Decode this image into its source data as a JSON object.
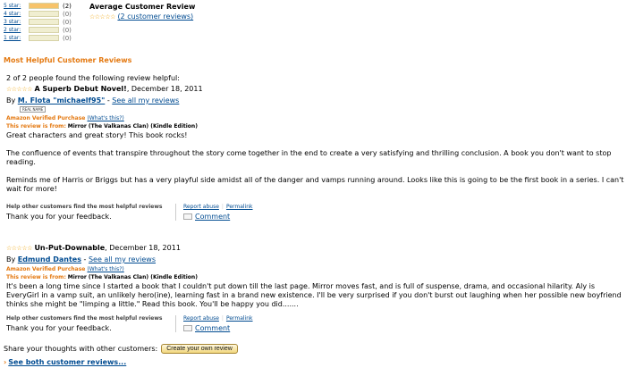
{
  "histogram": [
    {
      "label": "5 star:",
      "count": "(2)",
      "fraction": 1.0
    },
    {
      "label": "4 star:",
      "count": "(0)",
      "fraction": 0
    },
    {
      "label": "3 star:",
      "count": "(0)",
      "fraction": 0
    },
    {
      "label": "2 star:",
      "count": "(0)",
      "fraction": 0
    },
    {
      "label": "1 star:",
      "count": "(0)",
      "fraction": 0
    }
  ],
  "average": {
    "title": "Average Customer Review",
    "stars": "☆☆☆☆☆",
    "rating_out_of_5": 5,
    "reviews_link": "(2 customer reviews)"
  },
  "section_title": "Most Helpful Customer Reviews",
  "reviews": [
    {
      "helpful_count": "2 of 2 people found the following review helpful:",
      "stars": "☆☆☆☆☆",
      "rating_out_of_5": 5,
      "title": "A Superb Debut Novel!",
      "date": ", December 18, 2011",
      "by": "By",
      "author": "M. Flota \"michaelf95\"",
      "see_all": "See all my reviews",
      "real_name_badge": "REAL NAME",
      "verified": "Amazon Verified Purchase",
      "whats_this": "(What's this?)",
      "review_from_label": "This review is from:",
      "review_from_product": "Mirror (The Valkanas Clan) (Kindle Edition)",
      "paragraphs": [
        "Great characters and great story! This book rocks!",
        "The confluence of events that transpire throughout the story come together in the end to create a very satisfying and thrilling conclusion. A book you don't want to stop reading.",
        "Reminds me of Harris or Briggs but has a very playful side amidst all of the danger and vamps running around. Looks like this is going to be the first book in a series. I can't wait for more!"
      ],
      "feedback_help": "Help other customers find the most helpful reviews",
      "feedback_thanks": "Thank you for your feedback.",
      "report_abuse": "Report abuse",
      "permalink": "Permalink",
      "comment": "Comment"
    },
    {
      "stars": "☆☆☆☆☆",
      "rating_out_of_5": 5,
      "title": "Un-Put-Downable",
      "date": ", December 18, 2011",
      "by": "By",
      "author": "Edmund Dantes",
      "see_all": "See all my reviews",
      "verified": "Amazon Verified Purchase",
      "whats_this": "(What's this?)",
      "review_from_label": "This review is from:",
      "review_from_product": "Mirror (The Valkanas Clan) (Kindle Edition)",
      "paragraphs": [
        "It's been a long time since I started a book that I couldn't put down till the last page. Mirror moves fast, and is full of suspense, drama, and occasional hilarity. Aly is EveryGirl in a vamp suit, an unlikely hero(ine), learning fast in a brand new existence. I'll be very surprised if you don't burst out laughing when her possible new boyfriend thinks she might be \"limping a little.\" Read this book. You'll be happy you did......."
      ],
      "feedback_help": "Help other customers find the most helpful reviews",
      "feedback_thanks": "Thank you for your feedback.",
      "report_abuse": "Report abuse",
      "permalink": "Permalink",
      "comment": "Comment"
    }
  ],
  "share": {
    "text": "Share your thoughts with other customers:",
    "button": "Create your own review"
  },
  "see_both": "See both customer reviews...",
  "colors": {
    "link": "#004b91",
    "accent_orange": "#e47911",
    "bar_fill": "#f7c36a",
    "bar_empty": "#f0eed1",
    "star": "#f0a202"
  }
}
